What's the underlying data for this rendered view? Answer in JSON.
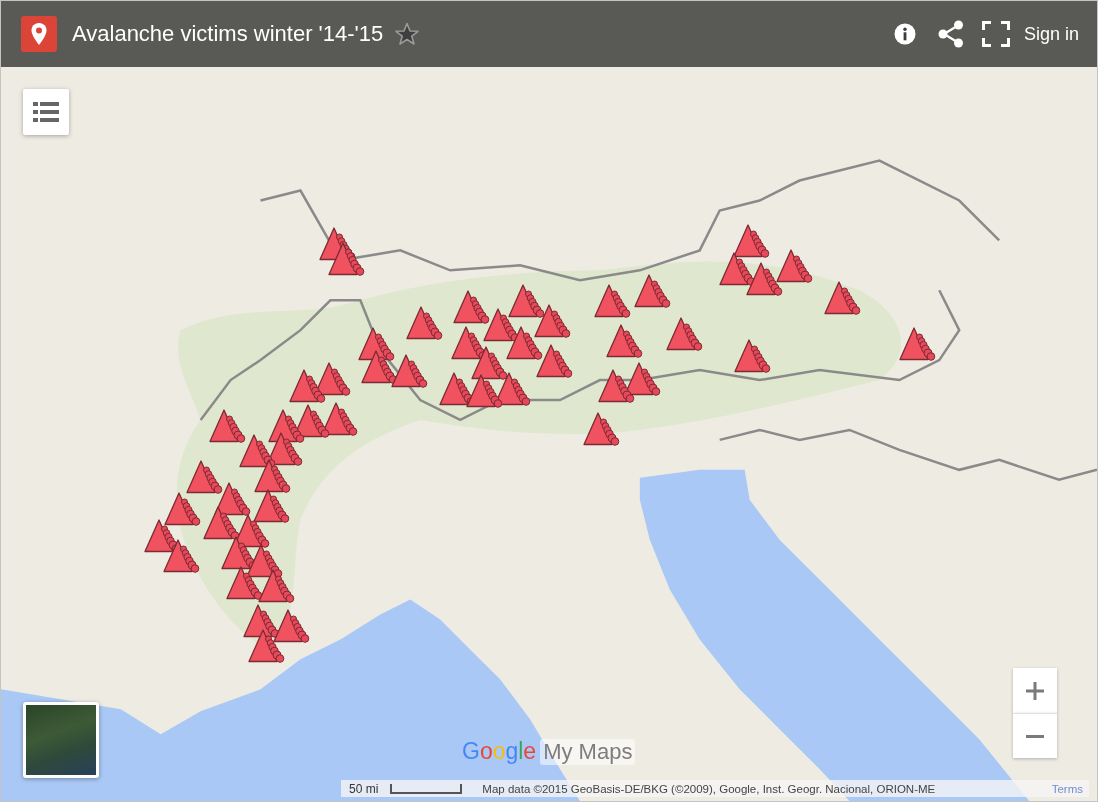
{
  "header": {
    "title": "Avalanche victims winter '14-'15",
    "starred": false,
    "sign_in": "Sign in"
  },
  "logo": {
    "brand": "Google",
    "product": "My Maps"
  },
  "footer": {
    "scale": "50 mi",
    "attribution": "Map data ©2015 GeoBasis-DE/BKG (©2009), Google, Inst. Geogr. Nacional, ORION-ME",
    "terms": "Terms"
  }
}
